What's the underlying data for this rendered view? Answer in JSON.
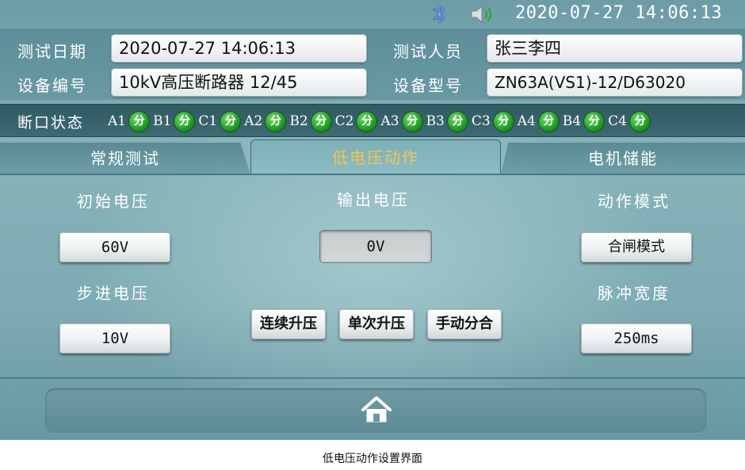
{
  "status_bar": {
    "datetime": "2020-07-27 14:06:13",
    "icons": [
      "bluetooth-icon",
      "speaker-icon"
    ]
  },
  "header": {
    "test_date_label": "测试日期",
    "test_date_value": "2020-07-27 14:06:13",
    "tester_label": "测试人员",
    "tester_value": "张三李四",
    "device_no_label": "设备编号",
    "device_no_value": "10kV高压断路器 12/45",
    "device_model_label": "设备型号",
    "device_model_value": "ZN63A(VS1)-12/D63020"
  },
  "breaker_state": {
    "label": "断口状态",
    "phases": [
      {
        "name": "A1",
        "state": "分"
      },
      {
        "name": "B1",
        "state": "分"
      },
      {
        "name": "C1",
        "state": "分"
      },
      {
        "name": "A2",
        "state": "分"
      },
      {
        "name": "B2",
        "state": "分"
      },
      {
        "name": "C2",
        "state": "分"
      },
      {
        "name": "A3",
        "state": "分"
      },
      {
        "name": "B3",
        "state": "分"
      },
      {
        "name": "C3",
        "state": "分"
      },
      {
        "name": "A4",
        "state": "分"
      },
      {
        "name": "B4",
        "state": "分"
      },
      {
        "name": "C4",
        "state": "分"
      }
    ],
    "led_color": "#1f9a22"
  },
  "tabs": [
    {
      "label": "常规测试",
      "active": false
    },
    {
      "label": "低电压动作",
      "active": true
    },
    {
      "label": "电机储能",
      "active": false
    }
  ],
  "active_tab_color": "#f4c64a",
  "main": {
    "initial_voltage_label": "初始电压",
    "initial_voltage_value": "60V",
    "step_voltage_label": "步进电压",
    "step_voltage_value": "10V",
    "output_voltage_label": "输出电压",
    "output_voltage_value": "0V",
    "mode_label": "动作模式",
    "mode_value": "合闸模式",
    "pulse_width_label": "脉冲宽度",
    "pulse_width_value": "250ms",
    "buttons": {
      "continuous": "连续升压",
      "single": "单次升压",
      "manual": "手动分合"
    }
  },
  "footer": {
    "home_icon": "home-icon"
  },
  "caption": "低电压动作设置界面"
}
